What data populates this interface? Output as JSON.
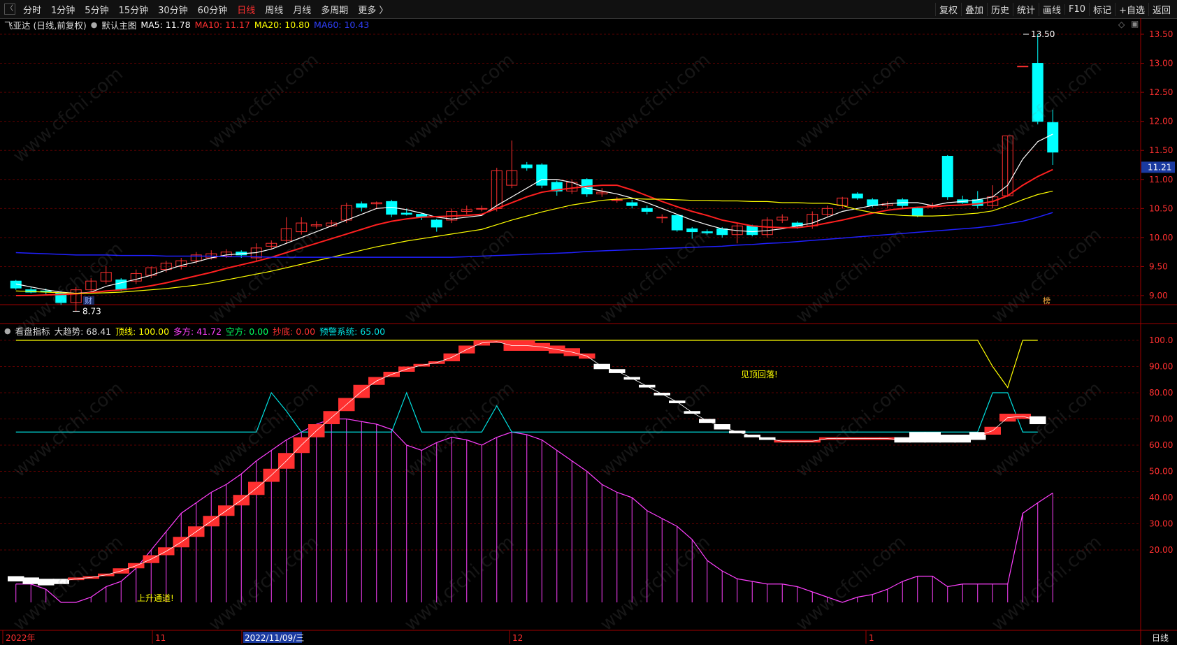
{
  "toolbar": {
    "back": "〈",
    "periods": [
      "分时",
      "1分钟",
      "5分钟",
      "15分钟",
      "30分钟",
      "60分钟",
      "日线",
      "周线",
      "月线",
      "多周期",
      "更多 〉"
    ],
    "active_index": 6,
    "right": [
      "复权",
      "叠加",
      "历史",
      "统计",
      "画线",
      "F10",
      "标记",
      "+自选",
      "返回"
    ]
  },
  "main_info": {
    "stock_title": "飞亚达 (日线,前复权)",
    "template_label": "默认主图",
    "ma5": "MA5: 11.78",
    "ma10": "MA10: 11.17",
    "ma20": "MA20: 10.80",
    "ma60": "MA60: 10.43"
  },
  "indicator_info": {
    "name": "看盘指标",
    "trend": "大趋势: 68.41",
    "top": "顶线: 100.00",
    "long": "多方: 41.72",
    "short": "空方: 0.00",
    "bottom": "抄底: 0.00",
    "warn": "预警系统: 65.00"
  },
  "price_axis": [
    "13.50",
    "13.00",
    "12.50",
    "12.00",
    "11.50",
    "11.00",
    "10.50",
    "10.00",
    "9.50",
    "9.00"
  ],
  "current_price": "11.21",
  "high_label": "13.50",
  "low_label": "8.73",
  "marker_cai": "财",
  "marker_bang": "榜",
  "ind_axis": [
    "100.0",
    "90.00",
    "80.00",
    "70.00",
    "60.00",
    "50.00",
    "40.00",
    "30.00",
    "20.00"
  ],
  "date_axis": [
    "2022年",
    "11",
    "2022/11/09/三",
    "12",
    "1"
  ],
  "period_label": "日线",
  "annotations": {
    "top_warn": "见顶回落!",
    "up_channel": "上升通道!"
  },
  "watermark": "www.cfchi.com",
  "colors": {
    "up": "#ff3030",
    "down": "#00ffff",
    "ma5": "#ffffff",
    "ma10": "#ff2020",
    "ma20": "#ffff00",
    "ma60": "#2020ff",
    "long": "#ff40ff",
    "warn": "#00e0e0"
  },
  "chart_data": {
    "type": "candlestick",
    "candles": [
      [
        9.25,
        9.13,
        9.27,
        9.1
      ],
      [
        9.1,
        9.06,
        9.15,
        9.04
      ],
      [
        9.08,
        9.07,
        9.12,
        9.02
      ],
      [
        9.05,
        8.88,
        9.08,
        8.84
      ],
      [
        8.88,
        9.1,
        9.15,
        8.73
      ],
      [
        9.1,
        9.25,
        9.3,
        9.05
      ],
      [
        9.25,
        9.4,
        9.5,
        9.2
      ],
      [
        9.27,
        9.1,
        9.3,
        9.08
      ],
      [
        9.25,
        9.38,
        9.45,
        9.2
      ],
      [
        9.35,
        9.48,
        9.5,
        9.3
      ],
      [
        9.45,
        9.56,
        9.6,
        9.4
      ],
      [
        9.5,
        9.6,
        9.65,
        9.45
      ],
      [
        9.6,
        9.7,
        9.75,
        9.55
      ],
      [
        9.65,
        9.72,
        9.78,
        9.62
      ],
      [
        9.68,
        9.75,
        9.8,
        9.65
      ],
      [
        9.75,
        9.7,
        9.78,
        9.65
      ],
      [
        9.65,
        9.82,
        9.9,
        9.6
      ],
      [
        9.85,
        9.9,
        9.95,
        9.8
      ],
      [
        9.95,
        10.15,
        10.35,
        9.9
      ],
      [
        10.1,
        10.25,
        10.35,
        10.05
      ],
      [
        10.2,
        10.22,
        10.28,
        10.15
      ],
      [
        10.2,
        10.25,
        10.3,
        10.18
      ],
      [
        10.3,
        10.55,
        10.6,
        10.25
      ],
      [
        10.58,
        10.52,
        10.62,
        10.45
      ],
      [
        10.58,
        10.6,
        10.62,
        10.5
      ],
      [
        10.62,
        10.4,
        10.65,
        10.35
      ],
      [
        10.42,
        10.4,
        10.5,
        10.38
      ],
      [
        10.4,
        10.35,
        10.42,
        10.3
      ],
      [
        10.3,
        10.18,
        10.32,
        10.1
      ],
      [
        10.3,
        10.45,
        10.5,
        10.25
      ],
      [
        10.45,
        10.48,
        10.55,
        10.4
      ],
      [
        10.5,
        10.5,
        10.55,
        10.45
      ],
      [
        10.5,
        11.15,
        11.2,
        10.45
      ],
      [
        10.9,
        11.15,
        11.67,
        10.85
      ],
      [
        11.25,
        11.2,
        11.3,
        11.15
      ],
      [
        11.25,
        10.9,
        11.28,
        10.85
      ],
      [
        10.95,
        10.8,
        10.98,
        10.72
      ],
      [
        10.8,
        10.95,
        11.0,
        10.75
      ],
      [
        11.0,
        10.75,
        11.02,
        10.7
      ],
      [
        10.75,
        10.78,
        10.85,
        10.7
      ],
      [
        10.65,
        10.65,
        10.7,
        10.6
      ],
      [
        10.6,
        10.55,
        10.65,
        10.5
      ],
      [
        10.5,
        10.45,
        10.55,
        10.4
      ],
      [
        10.35,
        10.35,
        10.4,
        10.25
      ],
      [
        10.38,
        10.13,
        10.4,
        10.1
      ],
      [
        10.15,
        10.1,
        10.18,
        9.98
      ],
      [
        10.1,
        10.08,
        10.14,
        10.05
      ],
      [
        10.15,
        10.05,
        10.18,
        10.0
      ],
      [
        10.05,
        10.2,
        10.25,
        9.9
      ],
      [
        10.2,
        10.05,
        10.22,
        10.02
      ],
      [
        10.05,
        10.3,
        10.35,
        10.0
      ],
      [
        10.3,
        10.35,
        10.4,
        10.25
      ],
      [
        10.25,
        10.2,
        10.28,
        10.15
      ],
      [
        10.2,
        10.4,
        10.45,
        10.15
      ],
      [
        10.4,
        10.5,
        10.55,
        10.35
      ],
      [
        10.55,
        10.68,
        10.7,
        10.5
      ],
      [
        10.75,
        10.68,
        10.78,
        10.65
      ],
      [
        10.65,
        10.55,
        10.68,
        10.52
      ],
      [
        10.55,
        10.58,
        10.62,
        10.5
      ],
      [
        10.65,
        10.55,
        10.68,
        10.5
      ],
      [
        10.5,
        10.38,
        10.52,
        10.35
      ],
      [
        10.55,
        10.55,
        10.6,
        10.5
      ],
      [
        11.4,
        10.7,
        11.42,
        10.65
      ],
      [
        10.65,
        10.6,
        10.72,
        10.58
      ],
      [
        10.65,
        10.55,
        10.8,
        10.5
      ],
      [
        10.55,
        10.7,
        10.9,
        10.5
      ],
      [
        10.72,
        11.75,
        11.75,
        10.7
      ],
      [
        12.95,
        12.95,
        12.95,
        12.95
      ],
      [
        13.0,
        12.0,
        13.5,
        11.95
      ],
      [
        11.98,
        11.47,
        12.2,
        11.25
      ]
    ],
    "ma5": [
      9.2,
      9.15,
      9.1,
      9.06,
      9.04,
      9.06,
      9.16,
      9.22,
      9.28,
      9.35,
      9.44,
      9.52,
      9.58,
      9.65,
      9.7,
      9.72,
      9.74,
      9.8,
      9.9,
      10.0,
      10.1,
      10.2,
      10.3,
      10.4,
      10.5,
      10.52,
      10.48,
      10.42,
      10.35,
      10.32,
      10.35,
      10.38,
      10.55,
      10.7,
      10.85,
      11.0,
      11.0,
      10.95,
      10.85,
      10.8,
      10.75,
      10.68,
      10.6,
      10.5,
      10.4,
      10.3,
      10.22,
      10.15,
      10.12,
      10.1,
      10.12,
      10.15,
      10.2,
      10.25,
      10.35,
      10.45,
      10.5,
      10.55,
      10.58,
      10.6,
      10.6,
      10.55,
      10.6,
      10.62,
      10.65,
      10.7,
      10.9,
      11.35,
      11.65,
      11.78
    ],
    "ma10": [
      9.0,
      9.0,
      9.01,
      9.02,
      9.03,
      9.05,
      9.08,
      9.1,
      9.13,
      9.17,
      9.22,
      9.28,
      9.34,
      9.4,
      9.47,
      9.53,
      9.59,
      9.66,
      9.74,
      9.82,
      9.9,
      9.98,
      10.06,
      10.14,
      10.22,
      10.28,
      10.32,
      10.35,
      10.36,
      10.37,
      10.38,
      10.4,
      10.5,
      10.6,
      10.7,
      10.78,
      10.82,
      10.85,
      10.88,
      10.9,
      10.9,
      10.82,
      10.72,
      10.62,
      10.53,
      10.45,
      10.38,
      10.3,
      10.25,
      10.2,
      10.18,
      10.17,
      10.17,
      10.2,
      10.25,
      10.3,
      10.36,
      10.42,
      10.47,
      10.5,
      10.52,
      10.53,
      10.55,
      10.56,
      10.58,
      10.62,
      10.72,
      10.9,
      11.05,
      11.17
    ],
    "ma20": [
      9.08,
      9.07,
      9.06,
      9.05,
      9.04,
      9.04,
      9.05,
      9.06,
      9.08,
      9.1,
      9.12,
      9.15,
      9.18,
      9.22,
      9.27,
      9.32,
      9.37,
      9.42,
      9.48,
      9.54,
      9.6,
      9.66,
      9.72,
      9.78,
      9.84,
      9.89,
      9.94,
      9.98,
      10.02,
      10.06,
      10.1,
      10.14,
      10.22,
      10.3,
      10.37,
      10.44,
      10.5,
      10.56,
      10.6,
      10.64,
      10.66,
      10.67,
      10.66,
      10.66,
      10.65,
      10.64,
      10.64,
      10.63,
      10.63,
      10.62,
      10.62,
      10.6,
      10.6,
      10.59,
      10.59,
      10.55,
      10.48,
      10.43,
      10.4,
      10.38,
      10.37,
      10.37,
      10.38,
      10.4,
      10.42,
      10.46,
      10.55,
      10.65,
      10.74,
      10.8
    ],
    "ma60": [
      9.74,
      9.73,
      9.72,
      9.71,
      9.7,
      9.7,
      9.7,
      9.69,
      9.69,
      9.69,
      9.68,
      9.68,
      9.68,
      9.68,
      9.67,
      9.67,
      9.67,
      9.66,
      9.66,
      9.66,
      9.66,
      9.66,
      9.66,
      9.66,
      9.66,
      9.66,
      9.66,
      9.66,
      9.66,
      9.66,
      9.67,
      9.68,
      9.69,
      9.7,
      9.71,
      9.72,
      9.73,
      9.74,
      9.76,
      9.77,
      9.78,
      9.79,
      9.8,
      9.81,
      9.82,
      9.83,
      9.84,
      9.85,
      9.87,
      9.88,
      9.9,
      9.91,
      9.93,
      9.95,
      9.97,
      9.99,
      10.01,
      10.03,
      10.05,
      10.07,
      10.09,
      10.11,
      10.13,
      10.15,
      10.17,
      10.2,
      10.24,
      10.28,
      10.35,
      10.43
    ],
    "long_line": [
      7,
      7,
      5,
      0,
      0,
      2,
      6,
      8,
      13,
      20,
      27,
      34,
      38,
      42,
      45,
      49,
      54,
      58,
      62,
      65,
      68,
      70,
      70,
      69,
      68,
      66,
      60,
      58,
      61,
      63,
      62,
      60,
      63,
      65,
      64,
      62,
      58,
      54,
      50,
      45,
      42,
      40,
      35,
      32,
      29,
      24,
      16,
      12,
      9,
      8,
      7,
      7,
      6,
      4,
      2,
      0,
      2,
      3,
      5,
      8,
      10,
      10,
      6,
      7,
      7,
      7,
      7,
      34,
      38,
      41.72
    ],
    "warn_line": [
      65,
      65,
      65,
      65,
      65,
      65,
      65,
      65,
      65,
      65,
      65,
      65,
      65,
      65,
      65,
      65,
      65,
      80,
      73,
      65,
      65,
      65,
      65,
      65,
      65,
      65,
      80,
      65,
      65,
      65,
      65,
      65,
      75,
      65,
      65,
      65,
      65,
      65,
      65,
      65,
      65,
      65,
      65,
      65,
      65,
      65,
      65,
      65,
      65,
      65,
      65,
      65,
      65,
      65,
      65,
      65,
      65,
      65,
      65,
      65,
      65,
      65,
      65,
      65,
      65,
      80,
      80,
      65,
      65
    ],
    "top_line": [
      100,
      100,
      100,
      100,
      100,
      100,
      100,
      100,
      100,
      100,
      100,
      100,
      100,
      100,
      100,
      100,
      100,
      100,
      100,
      100,
      100,
      100,
      100,
      100,
      100,
      100,
      100,
      100,
      100,
      100,
      100,
      100,
      100,
      100,
      100,
      100,
      100,
      100,
      100,
      100,
      100,
      100,
      100,
      100,
      100,
      100,
      100,
      100,
      100,
      100,
      100,
      100,
      100,
      100,
      100,
      100,
      100,
      100,
      100,
      100,
      100,
      100,
      100,
      100,
      100,
      90,
      82,
      100,
      100
    ],
    "trend_blocks": [
      [
        10,
        8,
        "w"
      ],
      [
        9.5,
        7,
        "w"
      ],
      [
        9,
        6.5,
        "w"
      ],
      [
        9,
        7,
        "w"
      ],
      [
        9.5,
        8.5,
        "r"
      ],
      [
        10,
        9,
        "r"
      ],
      [
        11,
        10,
        "r"
      ],
      [
        13,
        11,
        "r"
      ],
      [
        15,
        13,
        "r"
      ],
      [
        18,
        15,
        "r"
      ],
      [
        21,
        18,
        "r"
      ],
      [
        25,
        21,
        "r"
      ],
      [
        29,
        25,
        "r"
      ],
      [
        33,
        29,
        "r"
      ],
      [
        37,
        33,
        "r"
      ],
      [
        41,
        37,
        "r"
      ],
      [
        46,
        41,
        "r"
      ],
      [
        51,
        46,
        "r"
      ],
      [
        57,
        51,
        "r"
      ],
      [
        63,
        57,
        "r"
      ],
      [
        68,
        63,
        "r"
      ],
      [
        73,
        68,
        "r"
      ],
      [
        78,
        73,
        "r"
      ],
      [
        83,
        78,
        "r"
      ],
      [
        86,
        83,
        "r"
      ],
      [
        88,
        86,
        "r"
      ],
      [
        90,
        88,
        "r"
      ],
      [
        91,
        90,
        "r"
      ],
      [
        92,
        91,
        "r"
      ],
      [
        95,
        92,
        "r"
      ],
      [
        98,
        95,
        "r"
      ],
      [
        100,
        98,
        "r"
      ],
      [
        100,
        99,
        "r"
      ],
      [
        100,
        96,
        "r"
      ],
      [
        100,
        96,
        "r"
      ],
      [
        99,
        96,
        "r"
      ],
      [
        98,
        95,
        "r"
      ],
      [
        97,
        94,
        "r"
      ],
      [
        95,
        93,
        "r"
      ],
      [
        91,
        89,
        "w"
      ],
      [
        89,
        87.5,
        "w"
      ],
      [
        86,
        85,
        "w"
      ],
      [
        83,
        82,
        "w"
      ],
      [
        80,
        79,
        "w"
      ],
      [
        77,
        76,
        "w"
      ],
      [
        73,
        72,
        "w"
      ],
      [
        70,
        68.5,
        "w"
      ],
      [
        68,
        66,
        "w"
      ],
      [
        65.5,
        64.5,
        "w"
      ],
      [
        64,
        63,
        "w"
      ],
      [
        63,
        62,
        "w"
      ],
      [
        62,
        61,
        "r"
      ],
      [
        62,
        61,
        "r"
      ],
      [
        62,
        61,
        "r"
      ],
      [
        63,
        62,
        "r"
      ],
      [
        63,
        62,
        "r"
      ],
      [
        63,
        62,
        "r"
      ],
      [
        63,
        62,
        "r"
      ],
      [
        63,
        62,
        "r"
      ],
      [
        63,
        61,
        "w"
      ],
      [
        65,
        61,
        "w"
      ],
      [
        65,
        61,
        "w"
      ],
      [
        64,
        61,
        "w"
      ],
      [
        64,
        61,
        "w"
      ],
      [
        65,
        62,
        "w"
      ],
      [
        67,
        64,
        "r"
      ],
      [
        72,
        69,
        "r"
      ],
      [
        72,
        70,
        "r"
      ],
      [
        71,
        68,
        "w"
      ]
    ]
  }
}
